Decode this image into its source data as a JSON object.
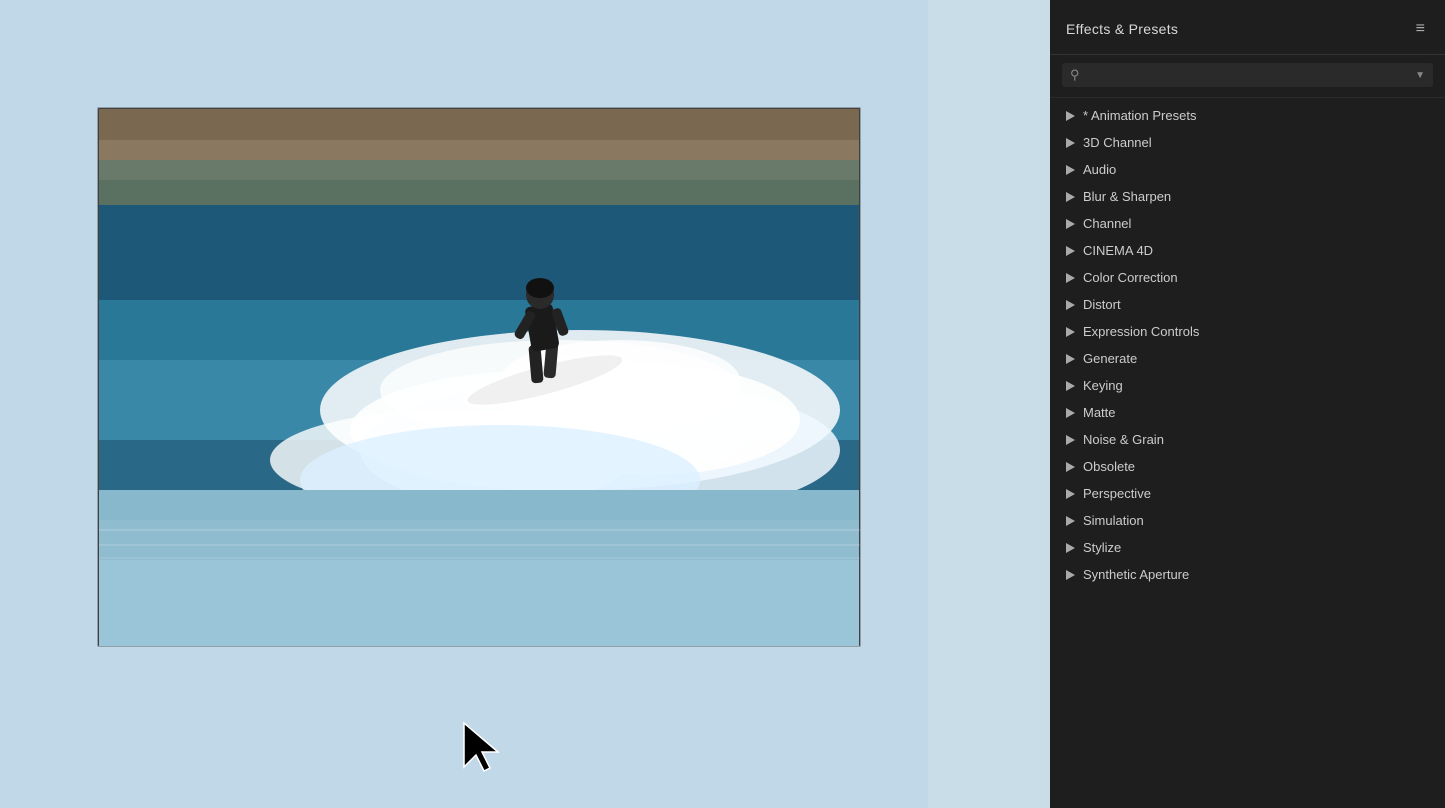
{
  "panel": {
    "title": "Effects & Presets",
    "menu_icon": "≡",
    "search_placeholder": ""
  },
  "effects_list": {
    "items": [
      {
        "id": "animation-presets",
        "label": "* Animation Presets",
        "has_star": true
      },
      {
        "id": "3d-channel",
        "label": "3D Channel",
        "has_star": false
      },
      {
        "id": "audio",
        "label": "Audio",
        "has_star": false
      },
      {
        "id": "blur-sharpen",
        "label": "Blur & Sharpen",
        "has_star": false
      },
      {
        "id": "channel",
        "label": "Channel",
        "has_star": false
      },
      {
        "id": "cinema-4d",
        "label": "CINEMA 4D",
        "has_star": false
      },
      {
        "id": "color-correction",
        "label": "Color Correction",
        "has_star": false
      },
      {
        "id": "distort",
        "label": "Distort",
        "has_star": false
      },
      {
        "id": "expression-controls",
        "label": "Expression Controls",
        "has_star": false
      },
      {
        "id": "generate",
        "label": "Generate",
        "has_star": false
      },
      {
        "id": "keying",
        "label": "Keying",
        "has_star": false
      },
      {
        "id": "matte",
        "label": "Matte",
        "has_star": false
      },
      {
        "id": "noise-grain",
        "label": "Noise & Grain",
        "has_star": false
      },
      {
        "id": "obsolete",
        "label": "Obsolete",
        "has_star": false
      },
      {
        "id": "perspective",
        "label": "Perspective",
        "has_star": false
      },
      {
        "id": "simulation",
        "label": "Simulation",
        "has_star": false
      },
      {
        "id": "stylize",
        "label": "Stylize",
        "has_star": false
      },
      {
        "id": "synthetic-aperture",
        "label": "Synthetic Aperture",
        "has_star": false
      }
    ]
  }
}
